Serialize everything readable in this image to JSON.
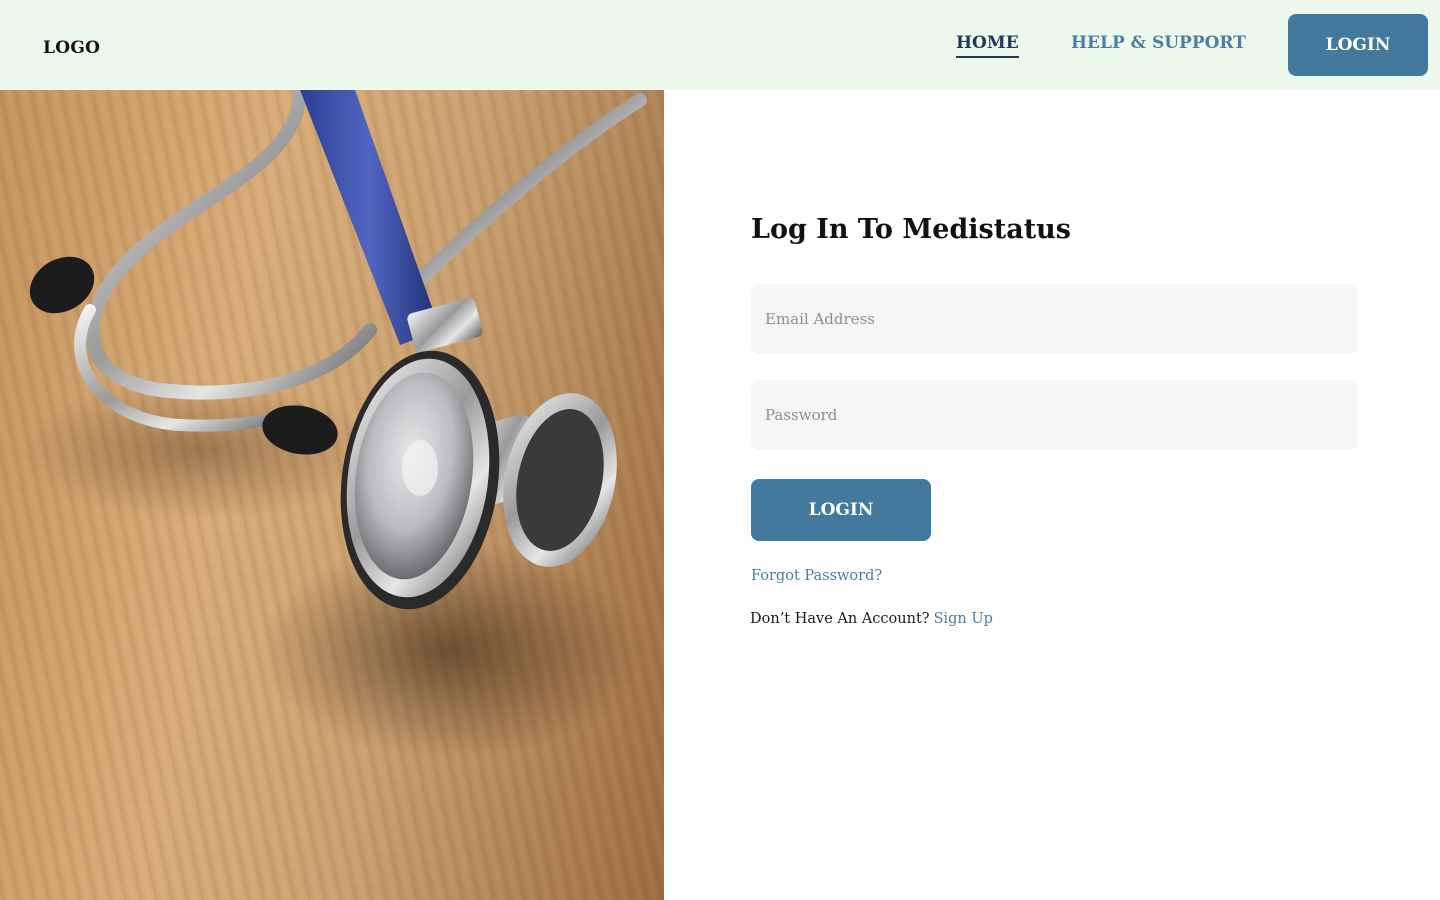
{
  "header": {
    "logo": "LOGO",
    "nav": {
      "home": "HOME",
      "help": "HELP & SUPPORT"
    },
    "login_label": "LOGIN"
  },
  "hero": {
    "image_icon": "stethoscope-photo"
  },
  "form": {
    "title": "Log In To Medistatus",
    "email": {
      "placeholder": "Email Address",
      "value": ""
    },
    "password": {
      "placeholder": "Password",
      "value": ""
    },
    "login_label": "LOGIN",
    "forgot_label": "Forgot Password?",
    "no_account_text": "Don’t Have An Account?",
    "signup_label": "Sign Up"
  },
  "colors": {
    "header_bg": "#eef9ee",
    "accent": "#44799e",
    "link": "#4b7ea2",
    "active_nav": "#223a5a",
    "field_bg": "#f6f6f6"
  }
}
